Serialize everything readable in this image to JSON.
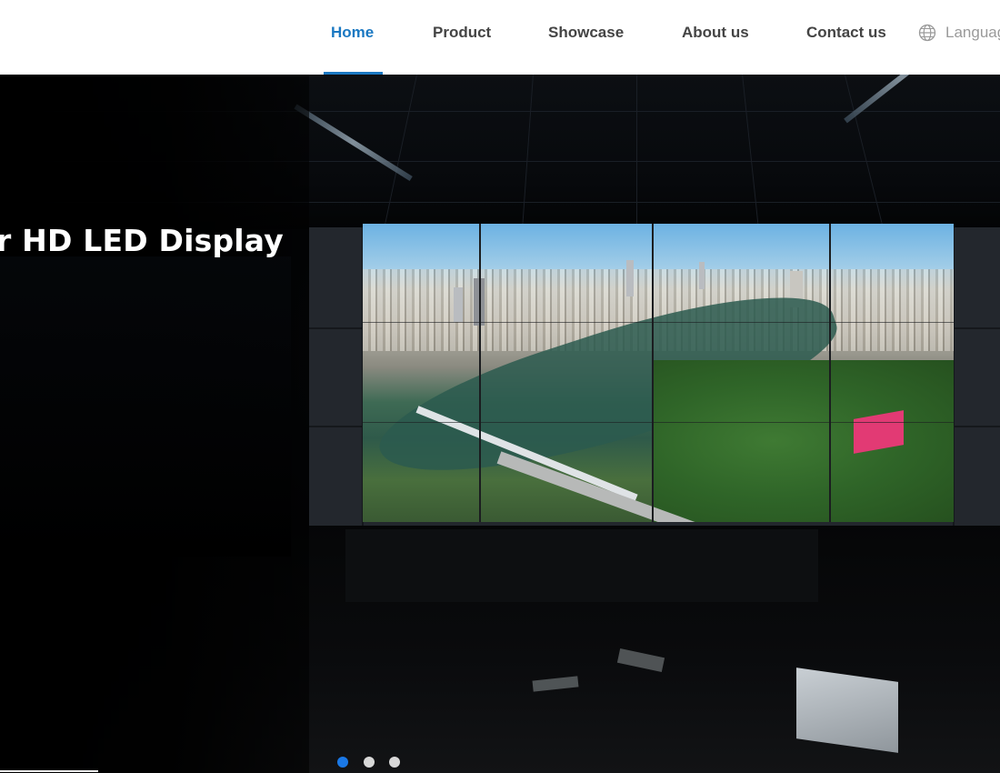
{
  "nav": {
    "items": [
      {
        "label": "Home",
        "active": true
      },
      {
        "label": "Product",
        "active": false
      },
      {
        "label": "Showcase",
        "active": false
      },
      {
        "label": "About us",
        "active": false
      },
      {
        "label": "Contact us",
        "active": false
      }
    ],
    "language_label": "Language",
    "language_icon": "globe-icon",
    "accent_color": "#1a78c2"
  },
  "hero": {
    "title": "r HD LED Display",
    "slide_count": 3,
    "active_slide": 1,
    "dot_active_color": "#1a78e6"
  }
}
